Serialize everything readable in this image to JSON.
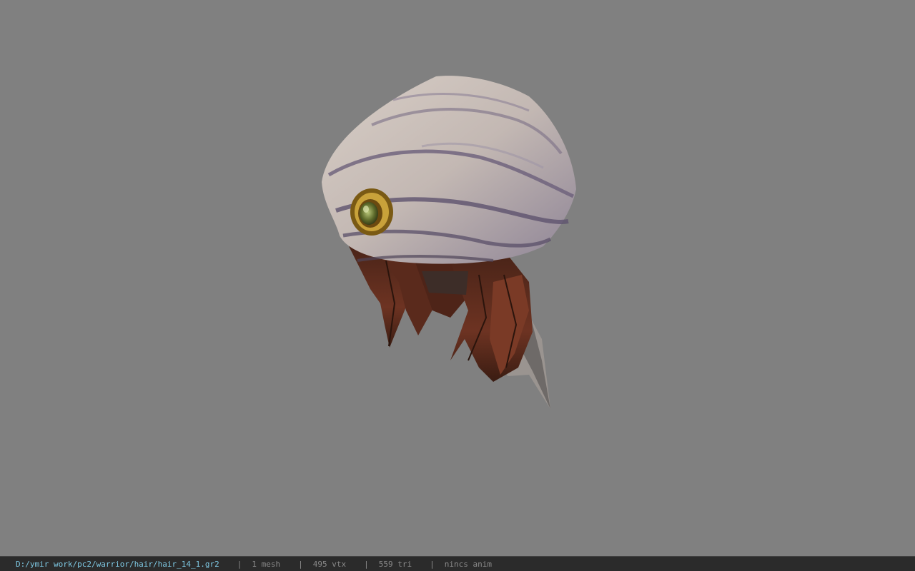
{
  "viewer": {
    "background_color": "#808080",
    "model_icon": "hair-turban-model"
  },
  "status": {
    "file_path": "D:/ymir work/pc2/warrior/hair/hair_14_1.gr2",
    "separator": "|",
    "mesh": "1 mesh",
    "vertices": "495 vtx",
    "triangles": "559 tri",
    "anim": "nincs anim",
    "path_color": "#7ec8e3"
  }
}
